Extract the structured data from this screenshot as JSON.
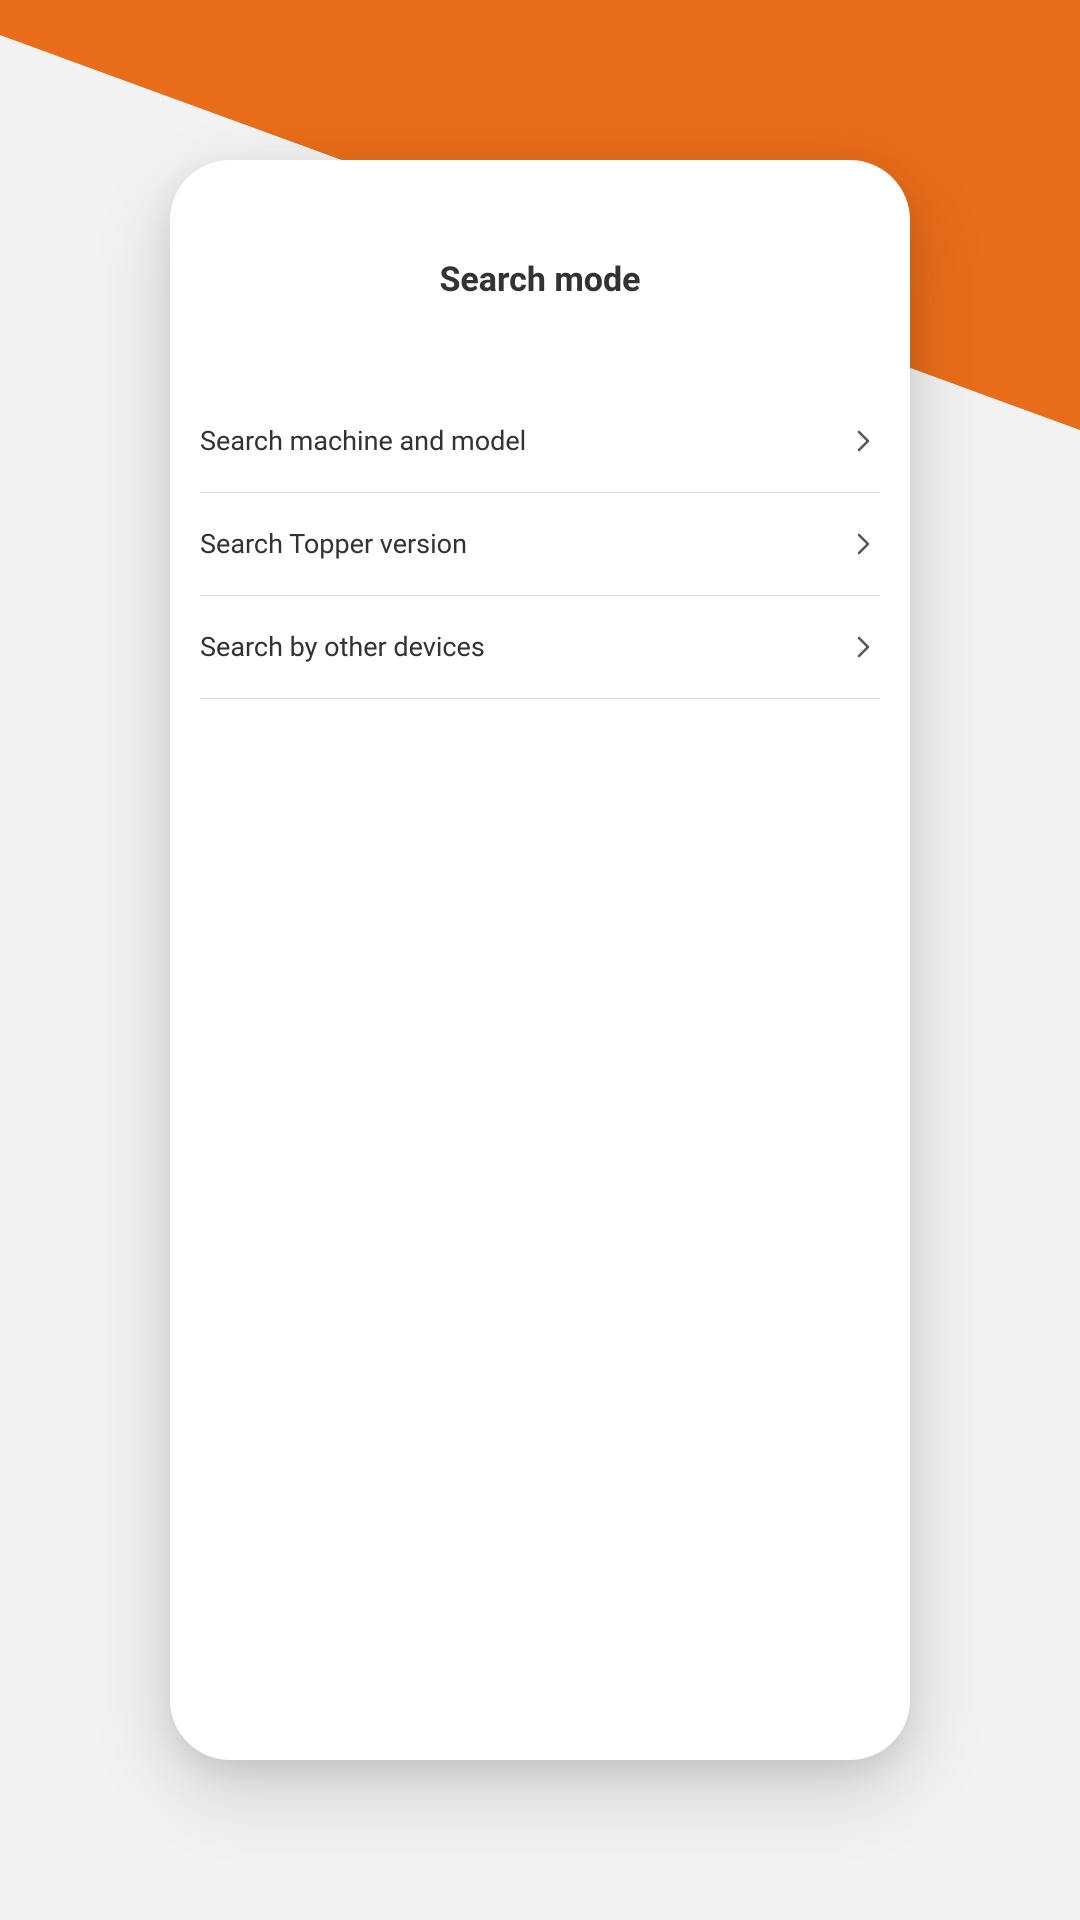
{
  "colors": {
    "accent": "#E86C1A",
    "background": "#f2f2f2",
    "card": "#ffffff",
    "text": "#333333",
    "divider": "#d8d8d8",
    "chevron": "#555555"
  },
  "header": {
    "title": "Search mode"
  },
  "list": {
    "items": [
      {
        "label": "Search machine and model"
      },
      {
        "label": "Search Topper version"
      },
      {
        "label": "Search by other devices"
      }
    ]
  }
}
